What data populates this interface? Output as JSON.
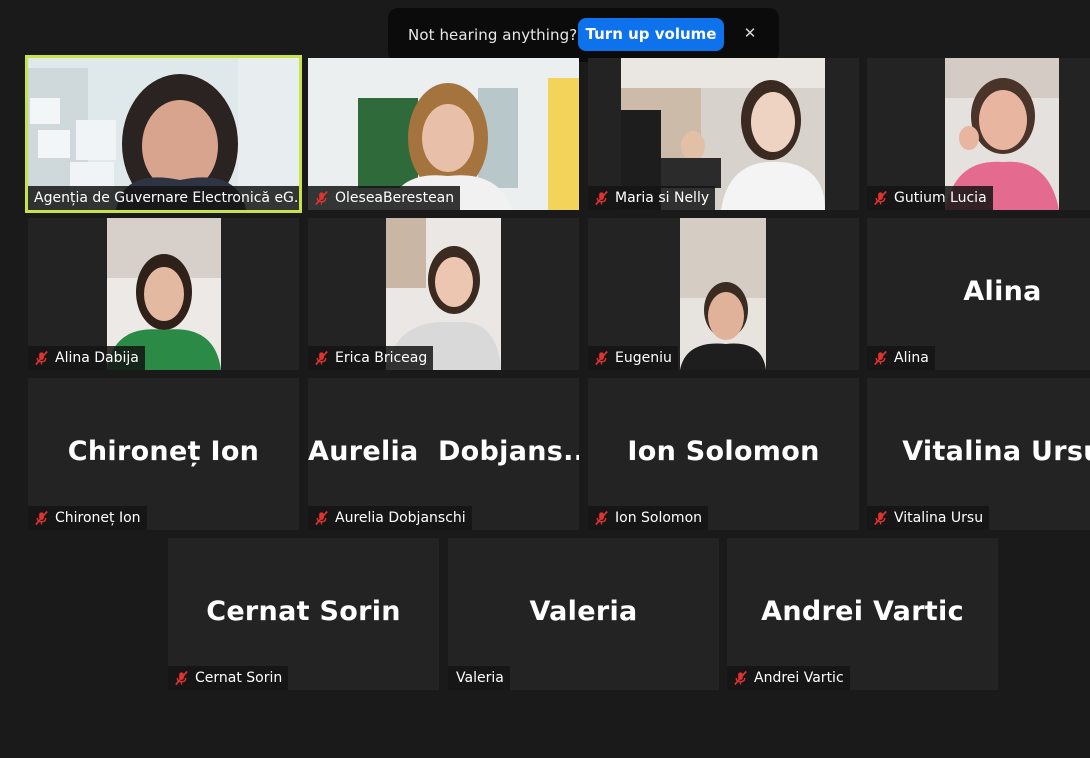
{
  "notification": {
    "message": "Not hearing anything?",
    "button_label": "Turn up volume",
    "close_glyph": "✕"
  },
  "participants": [
    {
      "label": "Agenția de Guvernare Electronică eG...",
      "video": true,
      "muted": false,
      "active": true
    },
    {
      "label": "OleseaBerestean",
      "video": true,
      "muted": true
    },
    {
      "label": "Maria si Nelly",
      "video": true,
      "muted": true
    },
    {
      "label": "Gutium Lucia",
      "video": true,
      "muted": true
    },
    {
      "label": "Alina Dabija",
      "video": true,
      "muted": true
    },
    {
      "label": "Erica Briceag",
      "video": true,
      "muted": true
    },
    {
      "label": "Eugeniu",
      "video": true,
      "muted": true
    },
    {
      "label": "Alina",
      "display_name": "Alina",
      "video": false,
      "muted": true
    },
    {
      "label": "Chironeț Ion",
      "display_name": "Chironeț Ion",
      "video": false,
      "muted": true
    },
    {
      "label": "Aurelia Dobjanschi",
      "display_name": "Aurelia  Dobjans...",
      "video": false,
      "muted": true
    },
    {
      "label": "Ion Solomon",
      "display_name": "Ion Solomon",
      "video": false,
      "muted": true
    },
    {
      "label": "Vitalina Ursu",
      "display_name": "Vitalina Ursu",
      "video": false,
      "muted": true
    },
    {
      "label": "Cernat Sorin",
      "display_name": "Cernat Sorin",
      "video": false,
      "muted": true
    },
    {
      "label": "Valeria",
      "display_name": "Valeria",
      "video": false,
      "muted": false
    },
    {
      "label": "Andrei Vartic",
      "display_name": "Andrei Vartic",
      "video": false,
      "muted": true
    }
  ],
  "colors": {
    "background": "#1a1a1a",
    "tile": "#232323",
    "active_speaker_border": "#c8e24a",
    "button": "#0e72ed",
    "muted_icon": "#e0322f"
  }
}
